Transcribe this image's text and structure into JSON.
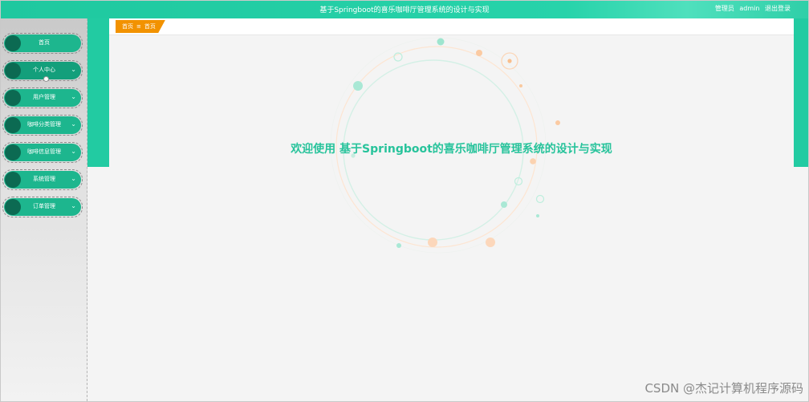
{
  "header": {
    "title": "基于Springboot的喜乐咖啡厅管理系统的设计与实现",
    "user_role": "管理员",
    "username": "admin",
    "logout_label": "退出登录"
  },
  "sidebar": {
    "items": [
      {
        "label": "首页",
        "has_dropdown": false,
        "active": false
      },
      {
        "label": "个人中心",
        "has_dropdown": true,
        "active": true
      },
      {
        "label": "用户管理",
        "has_dropdown": true,
        "active": false
      },
      {
        "label": "咖啡分类管理",
        "has_dropdown": true,
        "active": false
      },
      {
        "label": "咖啡信息管理",
        "has_dropdown": true,
        "active": false
      },
      {
        "label": "系统管理",
        "has_dropdown": true,
        "active": false
      },
      {
        "label": "订单管理",
        "has_dropdown": true,
        "active": false
      }
    ],
    "chevron_icon": "chevron-down-icon"
  },
  "breadcrumb": {
    "root": "首页",
    "separator": "≡",
    "current": "首页"
  },
  "main": {
    "welcome_text": "欢迎使用 基于Springboot的喜乐咖啡厅管理系统的设计与实现"
  },
  "watermark": "CSDN @杰记计算机程序源码",
  "colors": {
    "accent": "#22cba2",
    "menu": "#1db68e",
    "menu_dot": "#0c6a52",
    "breadcrumb": "#f29200",
    "welcome": "#27c39b"
  }
}
